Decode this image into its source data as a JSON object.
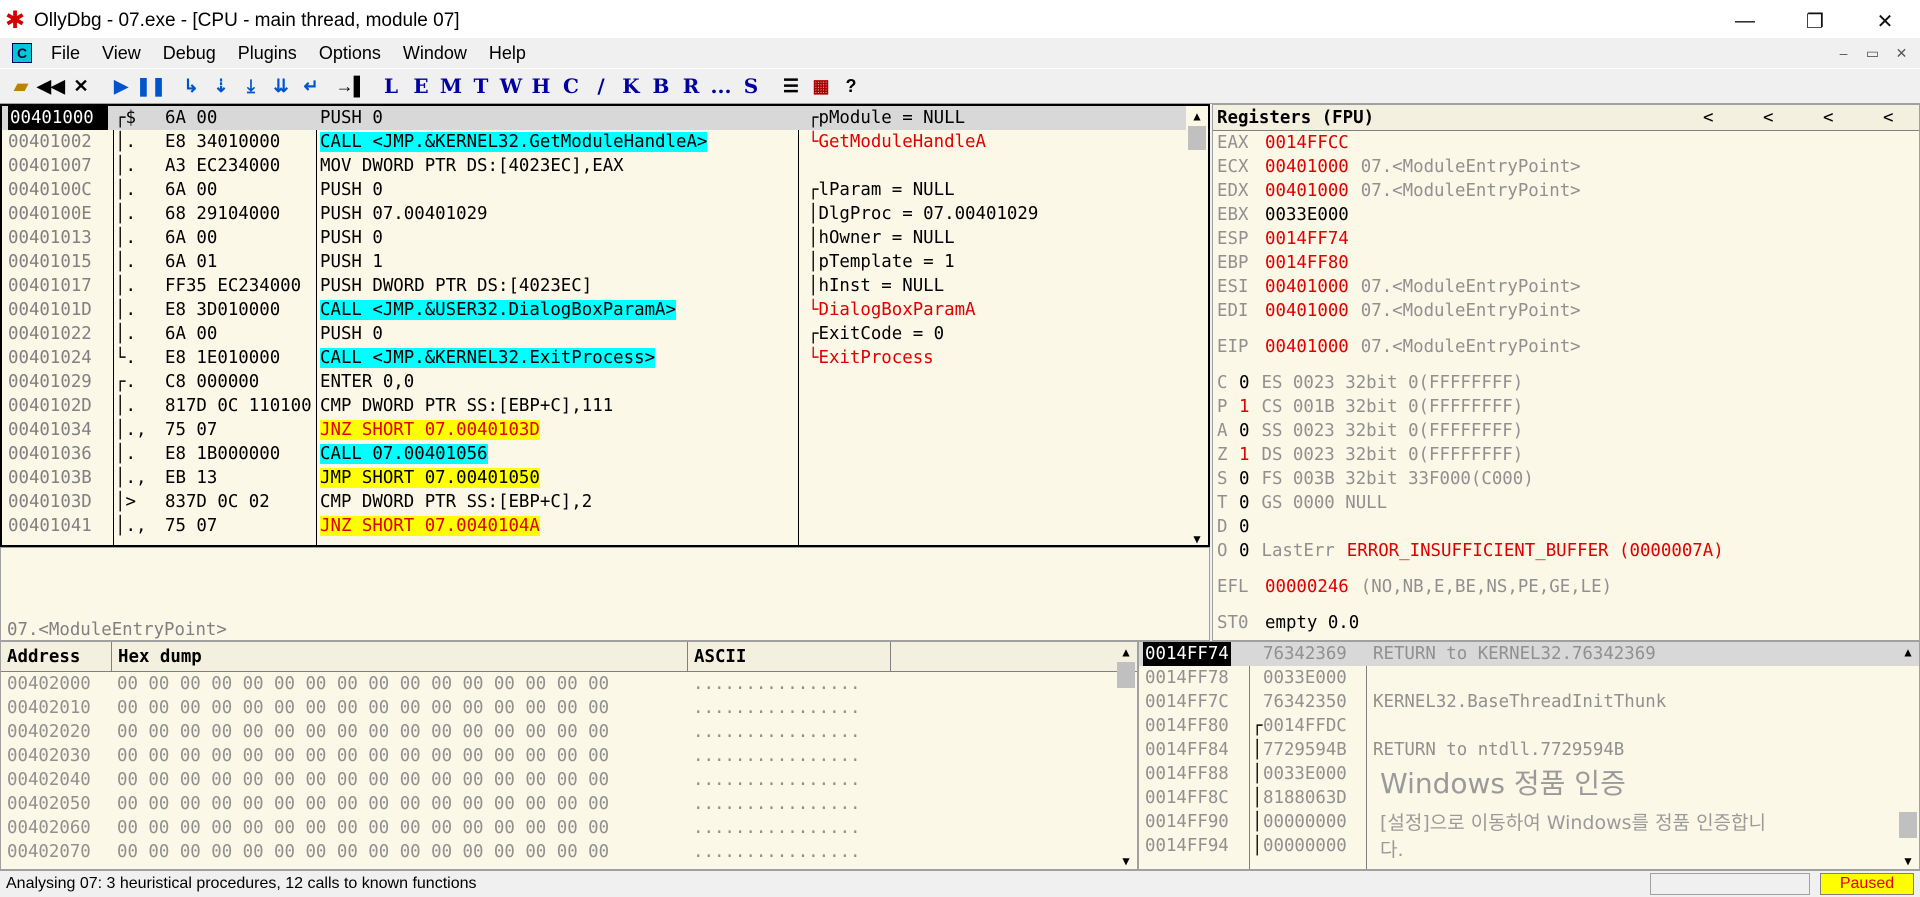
{
  "window": {
    "title": "OllyDbg - 07.exe - [CPU - main thread, module 07]",
    "minimize": "—",
    "maximize": "❐",
    "close": "✕",
    "mdi_min": "‒",
    "mdi_max": "▭",
    "mdi_close": "✕"
  },
  "menu": [
    "File",
    "View",
    "Debug",
    "Plugins",
    "Options",
    "Window",
    "Help"
  ],
  "toolbar": {
    "letters": [
      "L",
      "E",
      "M",
      "T",
      "W",
      "H",
      "C",
      "/",
      "K",
      "B",
      "R",
      "...",
      "S"
    ]
  },
  "disasm": {
    "rows": [
      {
        "addr": "00401000",
        "mk": "┌$",
        "hex": "6A 00",
        "ins": "PUSH 0",
        "cmt": "┌pModule = NULL",
        "sel": true
      },
      {
        "addr": "00401002",
        "mk": "│.",
        "hex": "E8 34010000",
        "ins": "CALL <JMP.&KERNEL32.GetModuleHandleA>",
        "cmt": "└GetModuleHandleA",
        "ins_hl": "cyan",
        "cmt_red": true
      },
      {
        "addr": "00401007",
        "mk": "│.",
        "hex": "A3 EC234000",
        "ins": "MOV DWORD PTR DS:[4023EC],EAX",
        "cmt": ""
      },
      {
        "addr": "0040100C",
        "mk": "│.",
        "hex": "6A 00",
        "ins": "PUSH 0",
        "cmt": "┌lParam = NULL"
      },
      {
        "addr": "0040100E",
        "mk": "│.",
        "hex": "68 29104000",
        "ins": "PUSH 07.00401029",
        "cmt": "│DlgProc = 07.00401029"
      },
      {
        "addr": "00401013",
        "mk": "│.",
        "hex": "6A 00",
        "ins": "PUSH 0",
        "cmt": "│hOwner = NULL"
      },
      {
        "addr": "00401015",
        "mk": "│.",
        "hex": "6A 01",
        "ins": "PUSH 1",
        "cmt": "│pTemplate = 1"
      },
      {
        "addr": "00401017",
        "mk": "│.",
        "hex": "FF35 EC234000",
        "ins": "PUSH DWORD PTR DS:[4023EC]",
        "cmt": "│hInst = NULL"
      },
      {
        "addr": "0040101D",
        "mk": "│.",
        "hex": "E8 3D010000",
        "ins": "CALL <JMP.&USER32.DialogBoxParamA>",
        "cmt": "└DialogBoxParamA",
        "ins_hl": "cyan",
        "cmt_red": true
      },
      {
        "addr": "00401022",
        "mk": "│.",
        "hex": "6A 00",
        "ins": "PUSH 0",
        "cmt": "┌ExitCode = 0"
      },
      {
        "addr": "00401024",
        "mk": "└.",
        "hex": "E8 1E010000",
        "ins": "CALL <JMP.&KERNEL32.ExitProcess>",
        "cmt": "└ExitProcess",
        "ins_hl": "cyan",
        "cmt_red": true
      },
      {
        "addr": "00401029",
        "mk": "┌.",
        "hex": "C8 000000",
        "ins": "ENTER 0,0",
        "cmt": ""
      },
      {
        "addr": "0040102D",
        "mk": "│.",
        "hex": "817D 0C 110100",
        "ins": "CMP DWORD PTR SS:[EBP+C],111",
        "cmt": ""
      },
      {
        "addr": "00401034",
        "mk": "│.,",
        "hex": "75 07",
        "ins": "JNZ SHORT 07.0040103D",
        "cmt": "",
        "ins_hl": "yellow",
        "ins_red": true
      },
      {
        "addr": "00401036",
        "mk": "│.",
        "hex": "E8 1B000000",
        "ins": "CALL 07.00401056",
        "cmt": "",
        "ins_hl": "cyan"
      },
      {
        "addr": "0040103B",
        "mk": "│.,",
        "hex": "EB 13",
        "ins": "JMP SHORT 07.00401050",
        "cmt": "",
        "ins_hl": "yellow"
      },
      {
        "addr": "0040103D",
        "mk": "│>",
        "hex": "837D 0C 02",
        "ins": "CMP DWORD PTR SS:[EBP+C],2",
        "cmt": ""
      },
      {
        "addr": "00401041",
        "mk": "│.,",
        "hex": "75 07",
        "ins": "JNZ SHORT 07.0040104A",
        "cmt": "",
        "ins_hl": "yellow",
        "ins_red": true
      }
    ]
  },
  "info": {
    "text": "07.<ModuleEntryPoint>"
  },
  "registers": {
    "title": "Registers (FPU)",
    "nav": [
      "<",
      "<",
      "<",
      "<"
    ],
    "rows": [
      {
        "name": "EAX",
        "val": "0014FFCC",
        "rest": "",
        "red": true
      },
      {
        "name": "ECX",
        "val": "00401000",
        "rest": "07.<ModuleEntryPoint>",
        "red": true
      },
      {
        "name": "EDX",
        "val": "00401000",
        "rest": "07.<ModuleEntryPoint>",
        "red": true
      },
      {
        "name": "EBX",
        "val": "0033E000",
        "rest": "",
        "red": false
      },
      {
        "name": "ESP",
        "val": "0014FF74",
        "rest": "",
        "red": true
      },
      {
        "name": "EBP",
        "val": "0014FF80",
        "rest": "",
        "red": true
      },
      {
        "name": "ESI",
        "val": "00401000",
        "rest": "07.<ModuleEntryPoint>",
        "red": true
      },
      {
        "name": "EDI",
        "val": "00401000",
        "rest": "07.<ModuleEntryPoint>",
        "red": true
      },
      {
        "name": "",
        "val": "",
        "rest": "",
        "red": false
      },
      {
        "name": "EIP",
        "val": "00401000",
        "rest": "07.<ModuleEntryPoint>",
        "red": true
      },
      {
        "name": "",
        "val": "",
        "rest": "",
        "red": false
      },
      {
        "name": "C",
        "val": "0",
        "rest": "ES 0023 32bit 0(FFFFFFFF)",
        "red": false
      },
      {
        "name": "P",
        "val": "1",
        "rest": "CS 001B 32bit 0(FFFFFFFF)",
        "red": true
      },
      {
        "name": "A",
        "val": "0",
        "rest": "SS 0023 32bit 0(FFFFFFFF)",
        "red": false
      },
      {
        "name": "Z",
        "val": "1",
        "rest": "DS 0023 32bit 0(FFFFFFFF)",
        "red": true
      },
      {
        "name": "S",
        "val": "0",
        "rest": "FS 003B 32bit 33F000(C000)",
        "red": false
      },
      {
        "name": "T",
        "val": "0",
        "rest": "GS 0000 NULL",
        "red": false
      },
      {
        "name": "D",
        "val": "0",
        "rest": "",
        "red": false
      },
      {
        "name": "O",
        "val": "0",
        "rest": "LastErr",
        "red": false,
        "extra": "ERROR_INSUFFICIENT_BUFFER (0000007A)"
      },
      {
        "name": "",
        "val": "",
        "rest": "",
        "red": false
      },
      {
        "name": "EFL",
        "val": "00000246",
        "rest": "(NO,NB,E,BE,NS,PE,GE,LE)",
        "red": true
      },
      {
        "name": "",
        "val": "",
        "rest": "",
        "red": false
      },
      {
        "name": "ST0",
        "val": "empty 0.0",
        "rest": "",
        "red": false
      }
    ]
  },
  "dump": {
    "headers": {
      "address": "Address",
      "hex": "Hex dump",
      "ascii": "ASCII"
    },
    "rows": [
      {
        "addr": "00402000",
        "hex": "00 00 00 00 00 00 00 00 00 00 00 00 00 00 00 00",
        "ascii": "................"
      },
      {
        "addr": "00402010",
        "hex": "00 00 00 00 00 00 00 00 00 00 00 00 00 00 00 00",
        "ascii": "................"
      },
      {
        "addr": "00402020",
        "hex": "00 00 00 00 00 00 00 00 00 00 00 00 00 00 00 00",
        "ascii": "................"
      },
      {
        "addr": "00402030",
        "hex": "00 00 00 00 00 00 00 00 00 00 00 00 00 00 00 00",
        "ascii": "................"
      },
      {
        "addr": "00402040",
        "hex": "00 00 00 00 00 00 00 00 00 00 00 00 00 00 00 00",
        "ascii": "................"
      },
      {
        "addr": "00402050",
        "hex": "00 00 00 00 00 00 00 00 00 00 00 00 00 00 00 00",
        "ascii": "................"
      },
      {
        "addr": "00402060",
        "hex": "00 00 00 00 00 00 00 00 00 00 00 00 00 00 00 00",
        "ascii": "................"
      },
      {
        "addr": "00402070",
        "hex": "00 00 00 00 00 00 00 00 00 00 00 00 00 00 00 00",
        "ascii": "................"
      }
    ]
  },
  "stack": {
    "rows": [
      {
        "addr": "0014FF74",
        "mk": "",
        "val": "76342369",
        "cmt": "RETURN to KERNEL32.76342369",
        "sel": true
      },
      {
        "addr": "0014FF78",
        "mk": "",
        "val": "0033E000",
        "cmt": ""
      },
      {
        "addr": "0014FF7C",
        "mk": "",
        "val": "76342350",
        "cmt": "KERNEL32.BaseThreadInitThunk"
      },
      {
        "addr": "0014FF80",
        "mk": "┌",
        "val": "0014FFDC",
        "cmt": ""
      },
      {
        "addr": "0014FF84",
        "mk": "│",
        "val": "7729594B",
        "cmt": "RETURN to ntdll.7729594B"
      },
      {
        "addr": "0014FF88",
        "mk": "│",
        "val": "0033E000",
        "cmt": ""
      },
      {
        "addr": "0014FF8C",
        "mk": "│",
        "val": "8188063D",
        "cmt": ""
      },
      {
        "addr": "0014FF90",
        "mk": "│",
        "val": "00000000",
        "cmt": ""
      },
      {
        "addr": "0014FF94",
        "mk": "│",
        "val": "00000000",
        "cmt": ""
      }
    ]
  },
  "watermark": {
    "line1": "Windows 정품 인증",
    "line2": "[설정]으로 이동하여 Windows를 정품 인증합니",
    "line3": "다."
  },
  "status": {
    "text": "Analysing 07: 3 heuristical procedures, 12 calls to known functions",
    "state": "Paused"
  }
}
